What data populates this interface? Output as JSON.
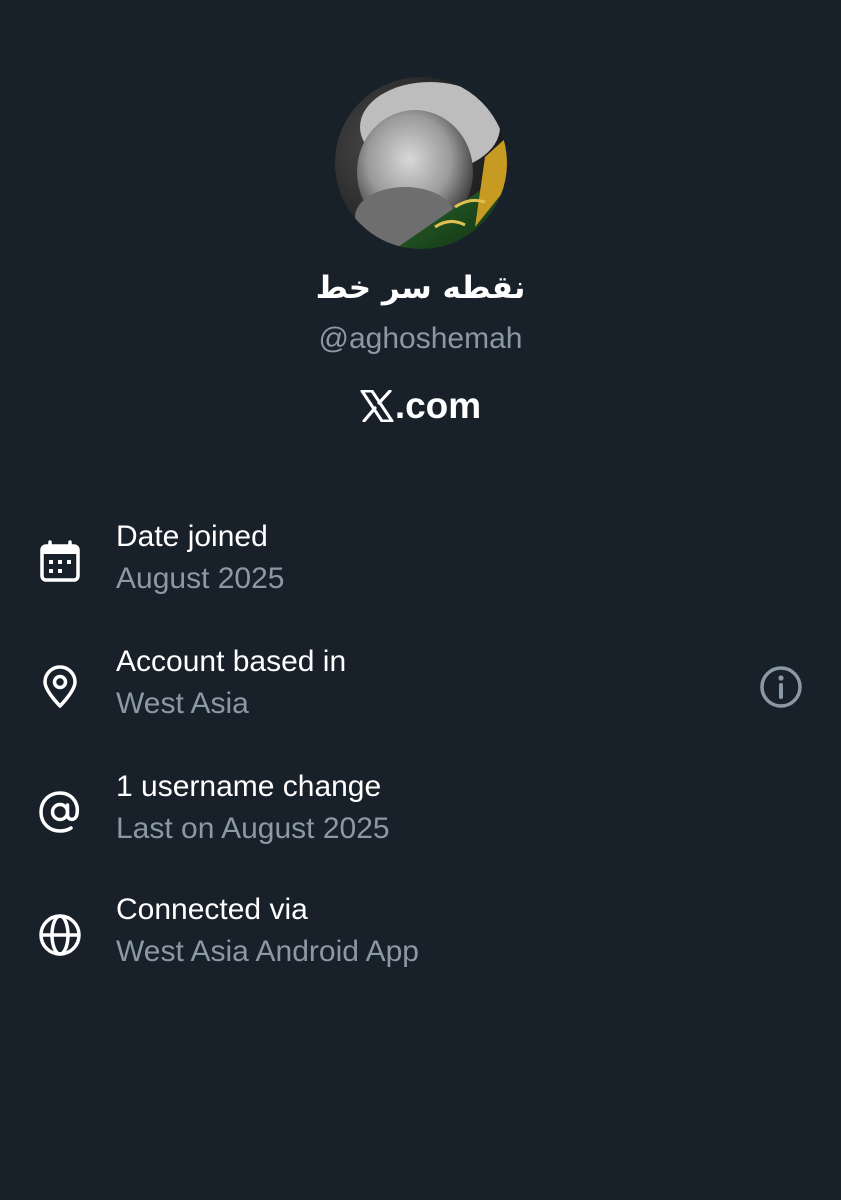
{
  "profile": {
    "display_name": "نقطه سر خط",
    "handle": "@aghoshemah",
    "site_label": ".com",
    "avatar_icon": "profile-photo"
  },
  "details": [
    {
      "icon": "calendar-icon",
      "title": "Date joined",
      "value": "August 2025"
    },
    {
      "icon": "location-pin-icon",
      "title": "Account based in",
      "value": "West Asia"
    },
    {
      "icon": "at-sign-icon",
      "title": "1 username change",
      "value": "Last on August 2025"
    },
    {
      "icon": "globe-icon",
      "title": "Connected via",
      "value": "West Asia Android App"
    }
  ],
  "colors": {
    "background": "#18202a",
    "primary_text": "#ffffff",
    "secondary_text": "#8b98a5"
  }
}
